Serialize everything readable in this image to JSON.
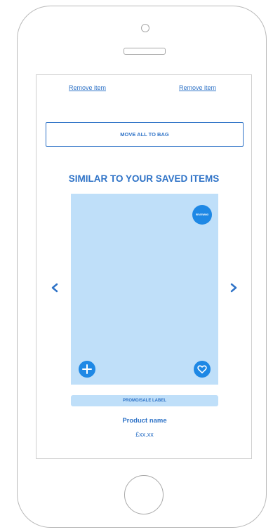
{
  "saved_items": {
    "remove_left_label": "Remove item",
    "remove_right_label": "Remove item",
    "move_all_label": "MOVE ALL TO BAG"
  },
  "similar_section": {
    "title": "SIMILAR TO YOUR SAVED ITEMS",
    "carousel": {
      "prev_icon": "chevron-left-icon",
      "next_icon": "chevron-right-icon"
    },
    "product": {
      "badge_label": "REVIEWING",
      "add_icon": "plus-icon",
      "save_icon": "heart-icon",
      "promo_label": "PROMO/SALE LABEL",
      "name": "Product name",
      "price": "£xx.xx"
    }
  },
  "colors": {
    "accent": "#2f73c7",
    "icon_fill": "#1e88e5",
    "image_placeholder": "#bfdff9",
    "device_outline": "#b9b9b9"
  }
}
